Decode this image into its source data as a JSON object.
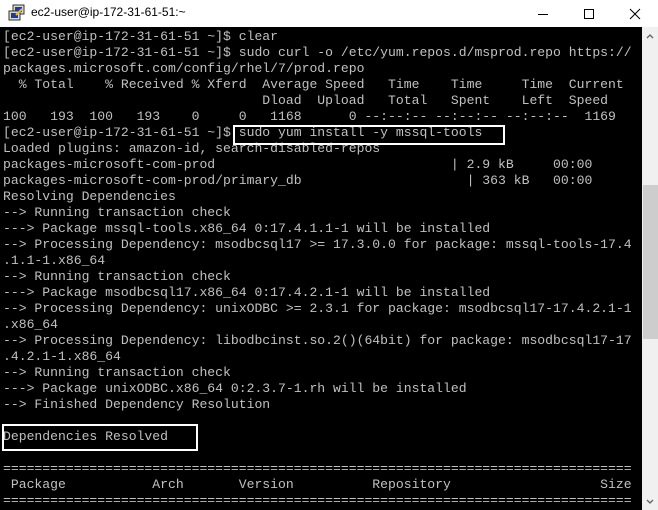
{
  "window": {
    "title": "ec2-user@ip-172-31-61-51:~",
    "controls": {
      "minimize_icon": "minimize-icon",
      "maximize_icon": "maximize-icon",
      "close_icon": "close-icon"
    },
    "colors": {
      "terminal_bg": "#000000",
      "terminal_fg": "#c0c0c0",
      "highlight_border": "#ffffff"
    }
  },
  "terminal": {
    "lines": [
      "[ec2-user@ip-172-31-61-51 ~]$ clear",
      "[ec2-user@ip-172-31-61-51 ~]$ sudo curl -o /etc/yum.repos.d/msprod.repo https://",
      "packages.microsoft.com/config/rhel/7/prod.repo",
      "  % Total    % Received % Xferd  Average Speed   Time    Time     Time  Current",
      "                                 Dload  Upload   Total   Spent    Left  Speed",
      "100   193  100   193    0     0   1168      0 --:--:-- --:--:-- --:--:--  1169",
      "[ec2-user@ip-172-31-61-51 ~]$ sudo yum install -y mssql-tools",
      "Loaded plugins: amazon-id, search-disabled-repos",
      "packages-microsoft-com-prod                              | 2.9 kB     00:00",
      "packages-microsoft-com-prod/primary_db                     | 363 kB   00:00",
      "Resolving Dependencies",
      "--> Running transaction check",
      "---> Package mssql-tools.x86_64 0:17.4.1.1-1 will be installed",
      "--> Processing Dependency: msodbcsql17 >= 17.3.0.0 for package: mssql-tools-17.4",
      ".1.1-1.x86_64",
      "--> Running transaction check",
      "---> Package msodbcsql17.x86_64 0:17.4.2.1-1 will be installed",
      "--> Processing Dependency: unixODBC >= 2.3.1 for package: msodbcsql17-17.4.2.1-1",
      ".x86_64",
      "--> Processing Dependency: libodbcinst.so.2()(64bit) for package: msodbcsql17-17",
      ".4.2.1-1.x86_64",
      "--> Running transaction check",
      "---> Package unixODBC.x86_64 0:2.3.7-1.rh will be installed",
      "--> Finished Dependency Resolution",
      "",
      "Dependencies Resolved",
      "",
      "================================================================================",
      " Package           Arch       Version          Repository                   Size",
      "================================================================================"
    ],
    "highlights": [
      {
        "label": "yum-install-command",
        "text": "sudo yum install -y mssql-tools"
      },
      {
        "label": "dependencies-resolved",
        "text": "Dependencies Resolved"
      }
    ]
  },
  "scrollbar": {
    "up_icon": "chevron-up-icon",
    "down_icon": "chevron-down-icon"
  }
}
